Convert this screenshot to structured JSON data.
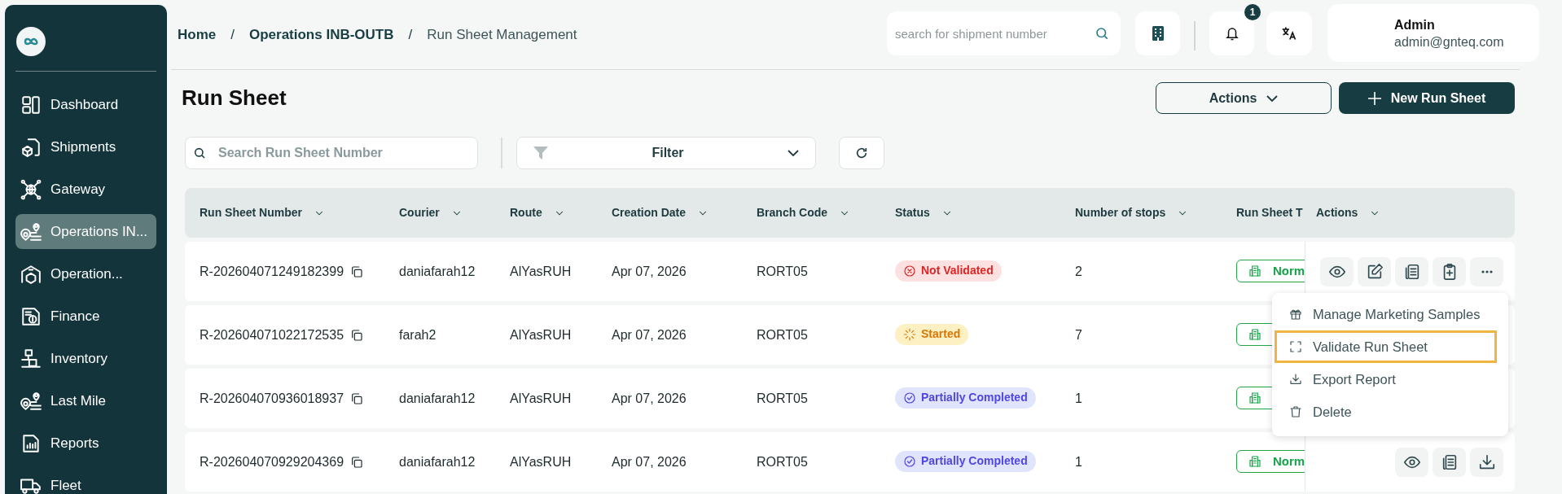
{
  "sidebar": {
    "items": [
      {
        "label": "Dashboard",
        "selected": false
      },
      {
        "label": "Shipments",
        "selected": false
      },
      {
        "label": "Gateway",
        "selected": false
      },
      {
        "label": "Operations IN...",
        "selected": true
      },
      {
        "label": "Operation...",
        "selected": false
      },
      {
        "label": "Finance",
        "selected": false
      },
      {
        "label": "Inventory",
        "selected": false
      },
      {
        "label": "Last Mile",
        "selected": false
      },
      {
        "label": "Reports",
        "selected": false
      },
      {
        "label": "Fleet",
        "selected": false
      }
    ]
  },
  "breadcrumb": [
    {
      "label": "Home",
      "kind": "link"
    },
    {
      "label": "/",
      "kind": "separator"
    },
    {
      "label": "Operations INB-OUTB",
      "kind": "link"
    },
    {
      "label": "/",
      "kind": "separator"
    },
    {
      "label": "Run Sheet Management",
      "kind": "current"
    }
  ],
  "header": {
    "search": {
      "placeholder": "search for shipment number"
    },
    "notifications": "1",
    "user": {
      "name": "Admin",
      "email": "admin@gnteq.com"
    }
  },
  "page": {
    "title": "Run Sheet",
    "actions_button": "Actions",
    "new_button": "New Run Sheet"
  },
  "toolbar": {
    "search": {
      "placeholder": "Search Run Sheet Number"
    },
    "filter": "Filter"
  },
  "table": {
    "columns": [
      "Run Sheet Number",
      "Courier",
      "Route",
      "Creation Date",
      "Branch Code",
      "Status",
      "Number of stops",
      "Run Sheet T",
      "Actions"
    ],
    "rows": [
      {
        "number": "R-202604071249182399",
        "courier": "daniafarah12",
        "route": "AlYasRUH",
        "date": "Apr 07, 2026",
        "branch": "RORT05",
        "status": {
          "label": "Not Validated",
          "kind": "not_validated"
        },
        "stops": "2",
        "type": "Norm",
        "actions": [
          {
            "kind": "view"
          },
          {
            "kind": "edit"
          },
          {
            "kind": "document"
          },
          {
            "kind": "clipboard"
          },
          {
            "kind": "more"
          }
        ]
      },
      {
        "number": "R-202604071022172535",
        "courier": "farah2",
        "route": "AlYasRUH",
        "date": "Apr 07, 2026",
        "branch": "RORT05",
        "status": {
          "label": "Started",
          "kind": "started"
        },
        "stops": "7"
      },
      {
        "number": "R-202604070936018937",
        "courier": "daniafarah12",
        "route": "AlYasRUH",
        "date": "Apr 07, 2026",
        "branch": "RORT05",
        "status": {
          "label": "Partially Completed",
          "kind": "partial"
        },
        "stops": "1"
      },
      {
        "number": "R-202604070929204369",
        "courier": "daniafarah12",
        "route": "AlYasRUH",
        "date": "Apr 07, 2026",
        "branch": "RORT05",
        "status": {
          "label": "Partially Completed",
          "kind": "partial"
        },
        "stops": "1",
        "type": "Norm",
        "actions": [
          {
            "kind": "view"
          },
          {
            "kind": "document"
          },
          {
            "kind": "download"
          }
        ]
      }
    ]
  },
  "menu": {
    "items": [
      {
        "label": "Manage Marketing Samples",
        "kind": "gift",
        "highlighted": false
      },
      {
        "label": "Validate Run Sheet",
        "kind": "scan",
        "highlighted": true
      },
      {
        "label": "Export Report",
        "kind": "download",
        "highlighted": false
      },
      {
        "label": "Delete",
        "kind": "trash",
        "highlighted": false
      }
    ]
  }
}
